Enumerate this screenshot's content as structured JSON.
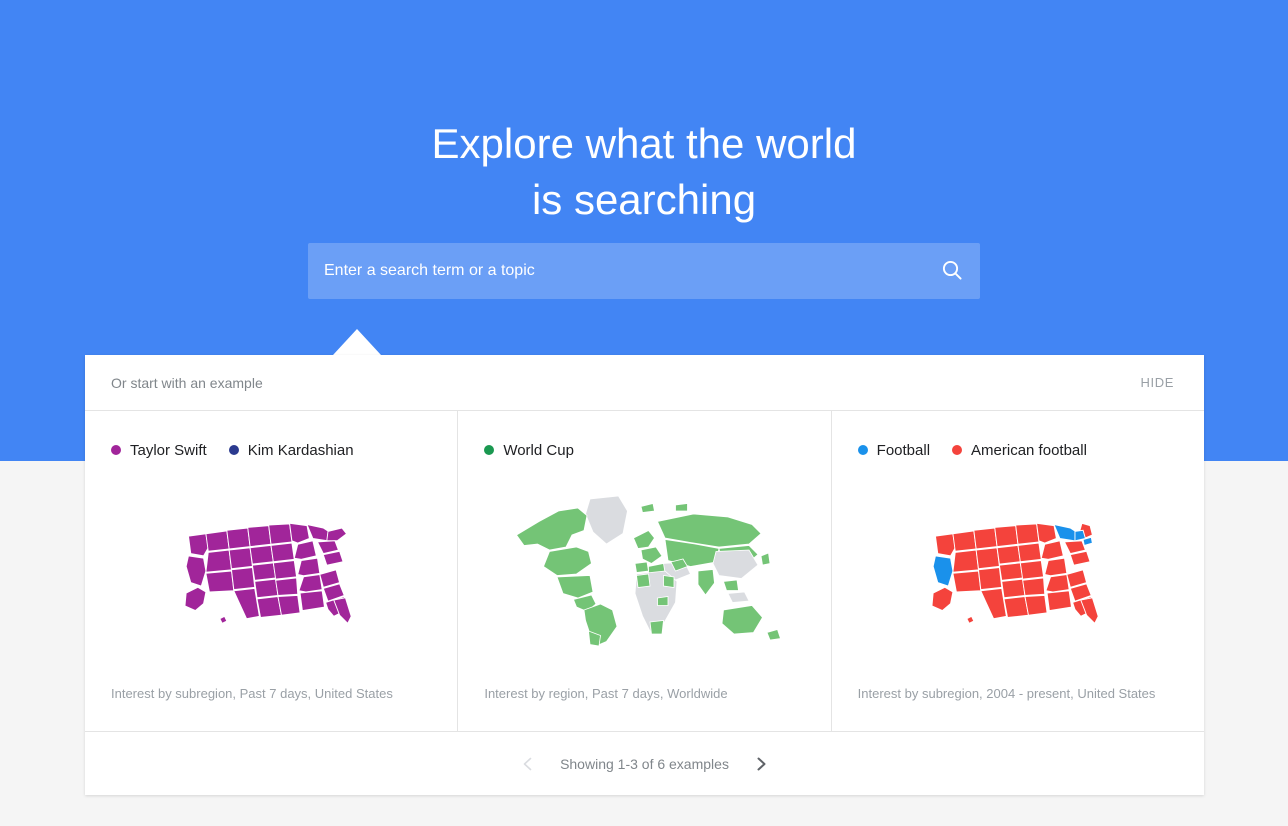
{
  "theme": {
    "hero_blue": "#4285f4",
    "page_background": "#f5f5f5",
    "panel_background": "#ffffff",
    "divider": "#e4e4e4",
    "muted_text": "#9aa0a6",
    "body_text": "#202124"
  },
  "hero": {
    "title_line_1": "Explore what the world",
    "title_line_2": "is searching",
    "search": {
      "placeholder": "Enter a search term or a topic",
      "value": "",
      "icon": "search-icon"
    }
  },
  "panel": {
    "header_label": "Or start with an example",
    "hide_label": "HIDE",
    "cards": [
      {
        "legend": [
          {
            "label": "Taylor Swift",
            "color": "#a1259a"
          },
          {
            "label": "Kim Kardashian",
            "color": "#2b3a8f"
          }
        ],
        "map": "united-states-map",
        "map_no_data_color": "#dadce0",
        "caption": "Interest by subregion, Past 7 days, United States"
      },
      {
        "legend": [
          {
            "label": "World Cup",
            "color": "#1a9850"
          }
        ],
        "map": "world-map",
        "map_region_color": "#74c476",
        "map_no_data_color": "#dadce0",
        "caption": "Interest by region, Past 7 days, Worldwide"
      },
      {
        "legend": [
          {
            "label": "Football",
            "color": "#1a91eb"
          },
          {
            "label": "American football",
            "color": "#f4433c"
          }
        ],
        "map": "united-states-map",
        "map_no_data_color": "#dadce0",
        "caption": "Interest by subregion, 2004 - present, United States"
      }
    ],
    "footer": {
      "prev_icon": "chevron-left-icon",
      "next_icon": "chevron-right-icon",
      "status": "Showing 1-3 of 6 examples",
      "prev_enabled": false,
      "next_enabled": true
    }
  }
}
